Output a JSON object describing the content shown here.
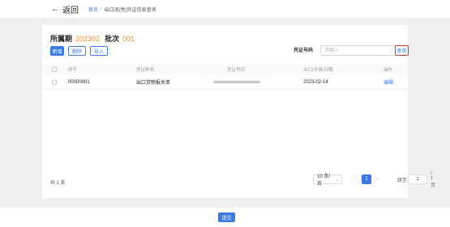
{
  "topbar": {
    "back_label": "返回",
    "breadcrumb": {
      "home": "首页",
      "separator": "/",
      "current": "出口退(免)凭证信息查询"
    }
  },
  "header": {
    "period_label": "所属期",
    "period_value": "202302",
    "batch_label": "批次",
    "batch_value": "001"
  },
  "toolbar": {
    "add_label": "新增",
    "delete_label": "删除",
    "import_label": "导入"
  },
  "search": {
    "label": "凭证号码",
    "placeholder": "请输入",
    "value": "",
    "query_label": "查询"
  },
  "table": {
    "columns": [
      "序号",
      "凭证种类",
      "凭证号码",
      "出口(开具)日期",
      "操作"
    ],
    "rows": [
      {
        "seq": "00000001",
        "type": "出口货物报关单",
        "voucher_no": "",
        "date": "2023-02-14",
        "action": "编辑"
      }
    ]
  },
  "pagination": {
    "total": "共 1 条",
    "page_size": "10 条/页",
    "prev": "‹",
    "current_page": "1",
    "next": "›",
    "goto_label": "跳至",
    "goto_value": "1",
    "total_pages": "/ 1 页"
  },
  "footer": {
    "submit_label": "提交"
  },
  "colors": {
    "primary": "#3b7ae0",
    "accent": "#f08c28",
    "highlight_border": "#d0391f"
  },
  "icons": {
    "back": "arrow-left-icon",
    "dropdown": "chevron-down-icon",
    "checkbox": "checkbox-icon"
  }
}
